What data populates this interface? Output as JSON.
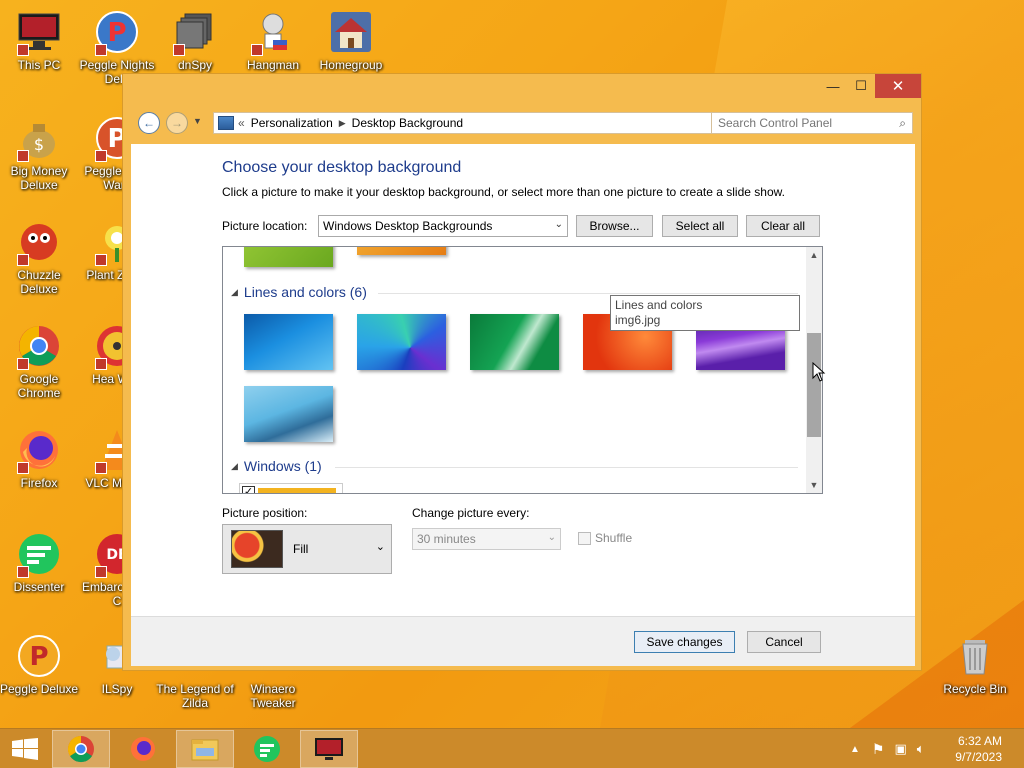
{
  "desktop": {
    "icons": [
      {
        "label": "This PC"
      },
      {
        "label": "Peggle Nights Delu"
      },
      {
        "label": "dnSpy"
      },
      {
        "label": "Hangman"
      },
      {
        "label": "Homegroup"
      },
      {
        "label": "Big Money Deluxe"
      },
      {
        "label": "Peggle W of Warc"
      },
      {
        "label": "Chuzzle Deluxe"
      },
      {
        "label": "Plant Zomb"
      },
      {
        "label": "Google Chrome"
      },
      {
        "label": "Hea Wea"
      },
      {
        "label": "Firefox"
      },
      {
        "label": "VLC M Play"
      },
      {
        "label": "Dissenter"
      },
      {
        "label": "Embarc Dev-C"
      },
      {
        "label": "Peggle Deluxe"
      },
      {
        "label": "ILSpy"
      },
      {
        "label": "The Legend of Zilda"
      },
      {
        "label": "Winaero Tweaker"
      },
      {
        "label": "Recycle Bin"
      }
    ]
  },
  "window": {
    "caption": {
      "minimize": "—",
      "maximize": "☐",
      "close": "✕"
    },
    "address": {
      "prefix": "«",
      "crumbs": [
        "Personalization",
        "Desktop Background"
      ]
    },
    "search": {
      "placeholder": "Search Control Panel"
    },
    "heading": "Choose your desktop background",
    "subtext": "Click a picture to make it your desktop background, or select more than one picture to create a slide show.",
    "picture_location": {
      "label": "Picture location:",
      "value": "Windows Desktop Backgrounds"
    },
    "buttons": {
      "browse": "Browse...",
      "select_all": "Select all",
      "clear_all": "Clear all"
    },
    "groups": [
      {
        "title": "Lines and colors (6)"
      },
      {
        "title": "Windows (1)"
      }
    ],
    "tooltip": {
      "line1": "Lines and colors",
      "line2": "img6.jpg"
    },
    "picture_position": {
      "label": "Picture position:",
      "value": "Fill"
    },
    "change_every": {
      "label": "Change picture every:",
      "value": "30 minutes"
    },
    "shuffle": {
      "label": "Shuffle"
    },
    "footer": {
      "save": "Save changes",
      "cancel": "Cancel"
    }
  },
  "taskbar": {
    "clock_time": "6:32 AM",
    "clock_date": "9/7/2023"
  },
  "colors": {
    "accent": "#1e3c8c",
    "close": "#c7453a",
    "window_border": "#f5bb4e"
  }
}
